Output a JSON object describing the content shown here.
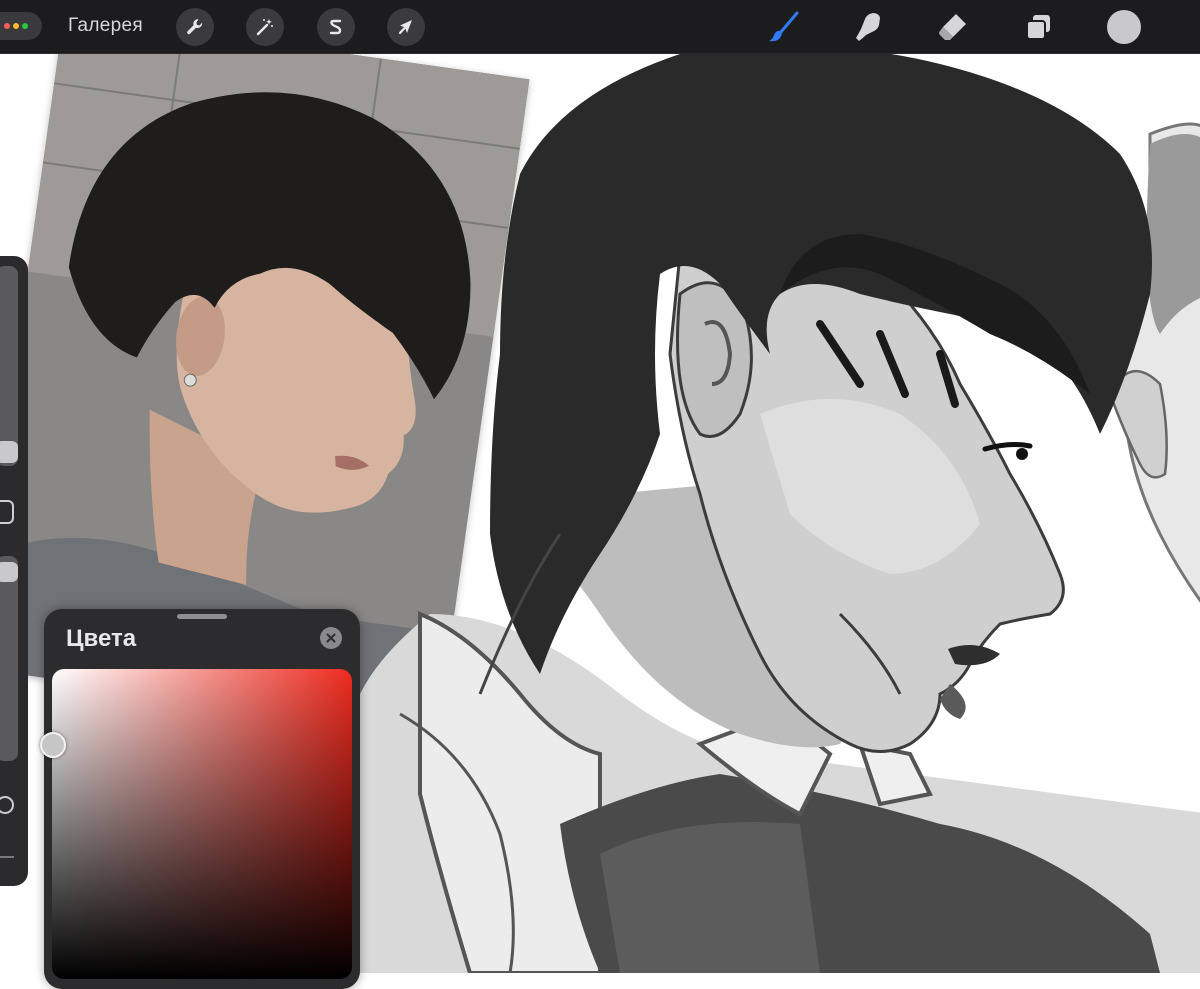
{
  "toolbar": {
    "gallery_label": "Галерея",
    "left_tools": [
      {
        "name": "actions",
        "icon": "wrench-icon"
      },
      {
        "name": "adjustments",
        "icon": "magic-wand-icon"
      },
      {
        "name": "selection",
        "icon": "selection-s-icon"
      },
      {
        "name": "transform",
        "icon": "arrow-cursor-icon"
      }
    ],
    "right_tools": [
      {
        "name": "brush",
        "icon": "brush-icon",
        "active": true,
        "color": "#2f7bf5"
      },
      {
        "name": "smudge",
        "icon": "smudge-finger-icon"
      },
      {
        "name": "eraser",
        "icon": "eraser-icon"
      },
      {
        "name": "layers",
        "icon": "layers-icon"
      }
    ],
    "current_color": "#c9c9cb"
  },
  "sidebar": {
    "brush_size_level": 0.9,
    "opacity_level": 0.05,
    "icons": [
      "square-modify-icon",
      "undo-icon",
      "redo-icon"
    ]
  },
  "color_panel": {
    "title": "Цвета",
    "close_icon": "close-icon",
    "hue_color": "#ee2b1f",
    "picker_saturation": 0.0,
    "picker_brightness": 0.78
  }
}
